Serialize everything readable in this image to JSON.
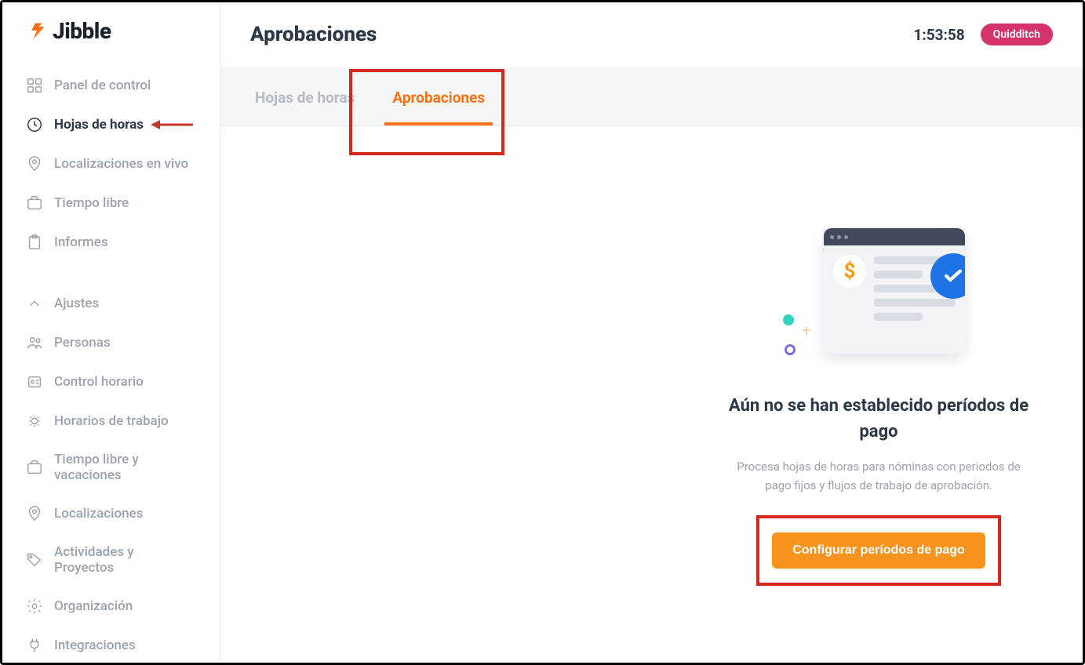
{
  "brand": {
    "name": "Jibble"
  },
  "sidebar": {
    "items": [
      {
        "label": "Panel de control",
        "icon": "dashboard"
      },
      {
        "label": "Hojas de horas",
        "icon": "clock",
        "active": true,
        "annotated": true
      },
      {
        "label": "Localizaciones en vivo",
        "icon": "pin"
      },
      {
        "label": "Tiempo libre",
        "icon": "briefcase"
      },
      {
        "label": "Informes",
        "icon": "clipboard"
      }
    ],
    "settings": [
      {
        "label": "Ajustes",
        "icon": "chevron"
      },
      {
        "label": "Personas",
        "icon": "people"
      },
      {
        "label": "Control horario",
        "icon": "badge"
      },
      {
        "label": "Horarios de trabajo",
        "icon": "schedule"
      },
      {
        "label": "Tiempo libre y vacaciones",
        "icon": "briefcase"
      },
      {
        "label": "Localizaciones",
        "icon": "pin"
      },
      {
        "label": "Actividades y Proyectos",
        "icon": "tag"
      },
      {
        "label": "Organización",
        "icon": "gear"
      },
      {
        "label": "Integraciones",
        "icon": "plug"
      }
    ]
  },
  "header": {
    "title": "Aprobaciones",
    "timer": "1:53:58",
    "badge": "Quidditch"
  },
  "tabs": [
    {
      "label": "Hojas de horas",
      "active": false
    },
    {
      "label": "Aprobaciones",
      "active": true
    }
  ],
  "empty_state": {
    "title": "Aún no se han establecido períodos de pago",
    "description": "Procesa hojas de horas para nóminas con periodos de pago fijos y flujos de trabajo de aprobación.",
    "cta": "Configurar períodos de pago"
  }
}
